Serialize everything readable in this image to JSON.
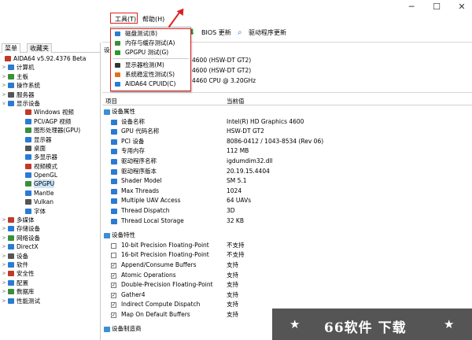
{
  "menubar": {
    "tools": "工具(T)",
    "help": "帮助(H)"
  },
  "toolbar": {
    "bios": "BIOS 更新",
    "driver": "驱动程序更新"
  },
  "sidebar": {
    "tabs": [
      "菜单",
      "收藏夹"
    ],
    "items": [
      {
        "label": "AIDA64 v5.92.4376 Beta",
        "indent": 0,
        "expander": ""
      },
      {
        "label": "计算机",
        "indent": 1,
        "expander": ">"
      },
      {
        "label": "主板",
        "indent": 1,
        "expander": ">"
      },
      {
        "label": "操作系统",
        "indent": 1,
        "expander": ">"
      },
      {
        "label": "服务器",
        "indent": 1,
        "expander": ">"
      },
      {
        "label": "显示设备",
        "indent": 1,
        "expander": "v"
      },
      {
        "label": "Windows 视频",
        "indent": 2,
        "expander": ""
      },
      {
        "label": "PCI/AGP 视频",
        "indent": 2,
        "expander": ""
      },
      {
        "label": "图形处理器(GPU)",
        "indent": 2,
        "expander": ""
      },
      {
        "label": "显示器",
        "indent": 2,
        "expander": ""
      },
      {
        "label": "桌面",
        "indent": 2,
        "expander": ""
      },
      {
        "label": "多显示器",
        "indent": 2,
        "expander": ""
      },
      {
        "label": "视频模式",
        "indent": 2,
        "expander": ""
      },
      {
        "label": "OpenGL",
        "indent": 2,
        "expander": ""
      },
      {
        "label": "GPGPU",
        "indent": 2,
        "expander": ""
      },
      {
        "label": "Mantle",
        "indent": 2,
        "expander": ""
      },
      {
        "label": "Vulkan",
        "indent": 2,
        "expander": ""
      },
      {
        "label": "字体",
        "indent": 2,
        "expander": ""
      },
      {
        "label": "多媒体",
        "indent": 1,
        "expander": ">"
      },
      {
        "label": "存储设备",
        "indent": 1,
        "expander": ">"
      },
      {
        "label": "网络设备",
        "indent": 1,
        "expander": ">"
      },
      {
        "label": "DirectX",
        "indent": 1,
        "expander": ">"
      },
      {
        "label": "设备",
        "indent": 1,
        "expander": ">"
      },
      {
        "label": "软件",
        "indent": 1,
        "expander": ">"
      },
      {
        "label": "安全性",
        "indent": 1,
        "expander": ">"
      },
      {
        "label": "配置",
        "indent": 1,
        "expander": ">"
      },
      {
        "label": "数据库",
        "indent": 1,
        "expander": ">"
      },
      {
        "label": "性能测试",
        "indent": 1,
        "expander": ">"
      }
    ]
  },
  "dropdown": {
    "items": [
      "磁盘测试(B)",
      "内存与缓存测试(A)",
      "GPGPU 测试(G)",
      "显示器检测(M)",
      "系统稳定性测试(S)",
      "AIDA64 CPUID(C)"
    ]
  },
  "summary": {
    "lines": [
      "4600 (HSW-DT GT2)",
      "4600 (HSW-DT GT2)",
      "4460 CPU @ 3.20GHz"
    ],
    "fragment": "设"
  },
  "columns": {
    "item": "项目",
    "value": "当前值"
  },
  "section_props": {
    "title": "设备属性",
    "rows": [
      {
        "k": "设备名称",
        "v": "Intel(R) HD Graphics 4600"
      },
      {
        "k": "GPU 代码名称",
        "v": "HSW-DT GT2"
      },
      {
        "k": "PCI 设备",
        "v": "8086-0412 / 1043-8534  (Rev 06)"
      },
      {
        "k": "专用内存",
        "v": "112 MB"
      },
      {
        "k": "驱动程序名称",
        "v": "igdumdim32.dll"
      },
      {
        "k": "驱动程序版本",
        "v": "20.19.15.4404"
      },
      {
        "k": "Shader Model",
        "v": "SM 5.1"
      },
      {
        "k": "Max Threads",
        "v": "1024"
      },
      {
        "k": "Multiple UAV Access",
        "v": "64 UAVs"
      },
      {
        "k": "Thread Dispatch",
        "v": "3D"
      },
      {
        "k": "Thread Local Storage",
        "v": "32 KB"
      }
    ]
  },
  "section_features": {
    "title": "设备特性",
    "rows": [
      {
        "k": "10-bit Precision Floating-Point",
        "v": "不支持",
        "checked": false
      },
      {
        "k": "16-bit Precision Floating-Point",
        "v": "不支持",
        "checked": false
      },
      {
        "k": "Append/Consume Buffers",
        "v": "支持",
        "checked": true
      },
      {
        "k": "Atomic Operations",
        "v": "支持",
        "checked": true
      },
      {
        "k": "Double-Precision Floating-Point",
        "v": "支持",
        "checked": true
      },
      {
        "k": "Gather4",
        "v": "支持",
        "checked": true
      },
      {
        "k": "Indirect Compute Dispatch",
        "v": "支持",
        "checked": true
      },
      {
        "k": "Map On Default Buffers",
        "v": "支持",
        "checked": true
      }
    ]
  },
  "section_vendor": {
    "title": "设备制造商"
  },
  "watermark": {
    "text": "66软件 下载",
    "star": "★"
  },
  "window_controls": {
    "min": "─",
    "max": "☐",
    "close": "✕"
  },
  "colors": {
    "red": "#e02020",
    "accent": "#2a7bd3"
  }
}
